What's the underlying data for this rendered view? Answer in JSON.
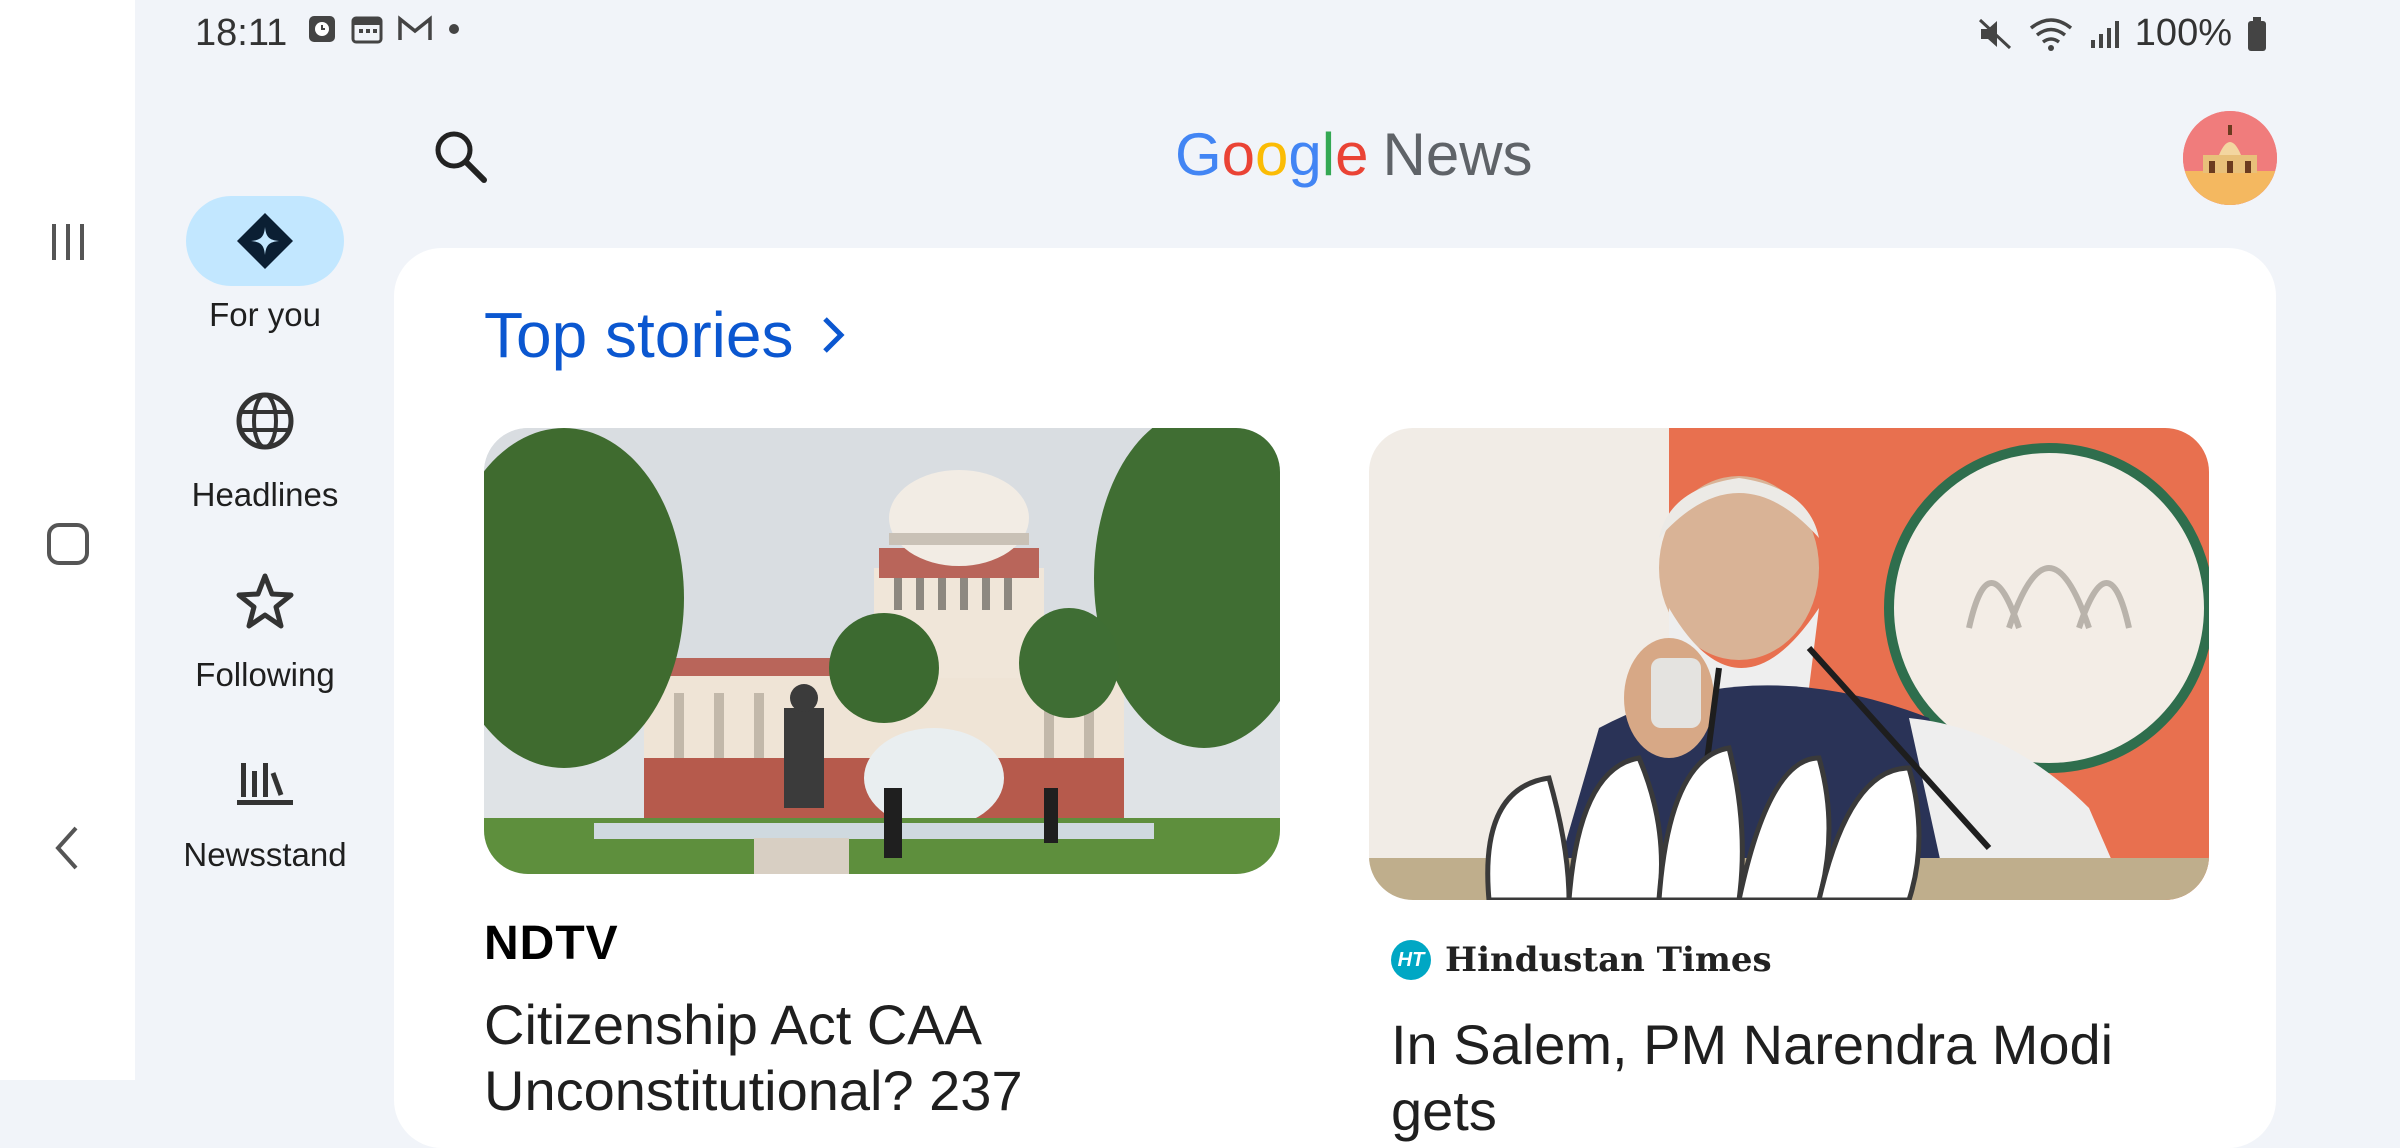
{
  "status_bar": {
    "time": "18:11",
    "battery": "100%"
  },
  "rail": {
    "items": [
      {
        "label": "For you",
        "icon": "for-you-diamond-icon",
        "active": true
      },
      {
        "label": "Headlines",
        "icon": "globe-icon",
        "active": false
      },
      {
        "label": "Following",
        "icon": "star-icon",
        "active": false
      },
      {
        "label": "Newsstand",
        "icon": "newsstand-bars-icon",
        "active": false
      }
    ]
  },
  "header": {
    "logo_google": "Google",
    "logo_news": "News"
  },
  "main": {
    "section_title": "Top stories",
    "stories": [
      {
        "source": "NDTV",
        "headline_line1": "Citizenship Act CAA",
        "headline_line2": "Unconstitutional? 237"
      },
      {
        "source": "Hindustan Times",
        "source_badge": "HT",
        "headline_line1": "In Salem, PM Narendra Modi gets"
      }
    ]
  },
  "colors": {
    "accent": "#0b57d0",
    "active_pill": "#c2e7ff",
    "background": "#f1f4f9"
  }
}
